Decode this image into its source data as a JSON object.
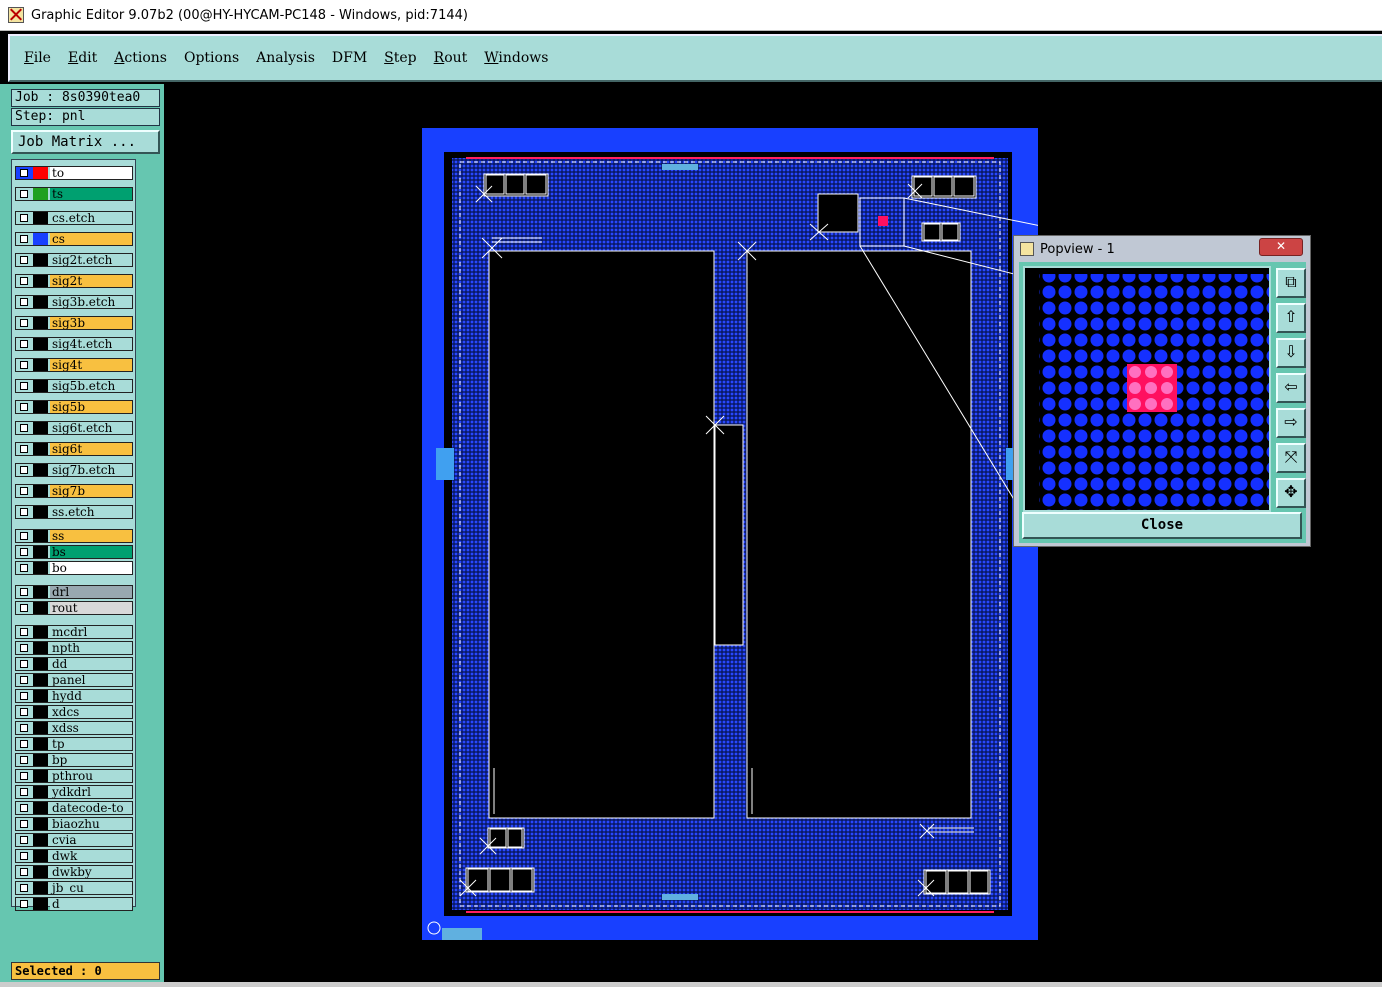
{
  "window": {
    "title": "Graphic Editor 9.07b2 (00@HY-HYCAM-PC148 - Windows, pid:7144)"
  },
  "menu": [
    {
      "label": "File",
      "underline": true
    },
    {
      "label": "Edit",
      "underline": true
    },
    {
      "label": "Actions",
      "underline": true
    },
    {
      "label": "Options",
      "underline": false
    },
    {
      "label": "Analysis",
      "underline": false
    },
    {
      "label": "DFM",
      "underline": false
    },
    {
      "label": "Step",
      "underline": true
    },
    {
      "label": "Rout",
      "underline": true
    },
    {
      "label": "Windows",
      "underline": true
    }
  ],
  "job": {
    "label": "Job : 8s0390tea0",
    "step": "Step: pnl"
  },
  "job_matrix": "Job Matrix ...",
  "layers": [
    {
      "name": "to",
      "color": "#ffffff",
      "swatch": "#ff0000",
      "highlight": true
    },
    {
      "name": "ts",
      "color": "#00a070",
      "swatch": "#20a020"
    },
    {
      "name": "cs.etch",
      "color": "#a8dcd8",
      "swatch": "#000000"
    },
    {
      "name": "cs",
      "color": "#f8c040",
      "swatch": "#1840ff"
    },
    {
      "name": "sig2t.etch",
      "color": "#a8dcd8",
      "swatch": "#000000"
    },
    {
      "name": "sig2t",
      "color": "#f8c040",
      "swatch": "#000000"
    },
    {
      "name": "sig3b.etch",
      "color": "#a8dcd8",
      "swatch": "#000000"
    },
    {
      "name": "sig3b",
      "color": "#f8c040",
      "swatch": "#000000"
    },
    {
      "name": "sig4t.etch",
      "color": "#a8dcd8",
      "swatch": "#000000"
    },
    {
      "name": "sig4t",
      "color": "#f8c040",
      "swatch": "#000000"
    },
    {
      "name": "sig5b.etch",
      "color": "#a8dcd8",
      "swatch": "#000000"
    },
    {
      "name": "sig5b",
      "color": "#f8c040",
      "swatch": "#000000"
    },
    {
      "name": "sig6t.etch",
      "color": "#a8dcd8",
      "swatch": "#000000"
    },
    {
      "name": "sig6t",
      "color": "#f8c040",
      "swatch": "#000000"
    },
    {
      "name": "sig7b.etch",
      "color": "#a8dcd8",
      "swatch": "#000000"
    },
    {
      "name": "sig7b",
      "color": "#f8c040",
      "swatch": "#000000"
    },
    {
      "name": "ss.etch",
      "color": "#a8dcd8",
      "swatch": "#000000"
    },
    {
      "name": "ss",
      "color": "#f8c040",
      "swatch": "#000000"
    },
    {
      "name": "bs",
      "color": "#00a070",
      "swatch": "#000000"
    },
    {
      "name": "bo",
      "color": "#ffffff",
      "swatch": "#000000"
    },
    {
      "name": "drl",
      "color": "#98a8b0",
      "swatch": "#000000"
    },
    {
      "name": "rout",
      "color": "#d8d8d8",
      "swatch": "#000000"
    },
    {
      "name": "mcdrl",
      "color": "#a8dcd8",
      "swatch": "#000000"
    },
    {
      "name": "npth",
      "color": "#a8dcd8",
      "swatch": "#000000"
    },
    {
      "name": "dd",
      "color": "#a8dcd8",
      "swatch": "#000000"
    },
    {
      "name": "panel",
      "color": "#a8dcd8",
      "swatch": "#000000"
    },
    {
      "name": "hydd",
      "color": "#a8dcd8",
      "swatch": "#000000"
    },
    {
      "name": "xdcs",
      "color": "#a8dcd8",
      "swatch": "#000000"
    },
    {
      "name": "xdss",
      "color": "#a8dcd8",
      "swatch": "#000000"
    },
    {
      "name": "tp",
      "color": "#a8dcd8",
      "swatch": "#000000"
    },
    {
      "name": "bp",
      "color": "#a8dcd8",
      "swatch": "#000000"
    },
    {
      "name": "pthrou",
      "color": "#a8dcd8",
      "swatch": "#000000"
    },
    {
      "name": "ydkdrl",
      "color": "#a8dcd8",
      "swatch": "#000000"
    },
    {
      "name": "datecode-to",
      "color": "#a8dcd8",
      "swatch": "#000000"
    },
    {
      "name": "biaozhu",
      "color": "#a8dcd8",
      "swatch": "#000000"
    },
    {
      "name": "cvia",
      "color": "#a8dcd8",
      "swatch": "#000000"
    },
    {
      "name": "dwk",
      "color": "#a8dcd8",
      "swatch": "#000000"
    },
    {
      "name": "dwkby",
      "color": "#a8dcd8",
      "swatch": "#000000"
    },
    {
      "name": "jb_cu",
      "color": "#a8dcd8",
      "swatch": "#000000"
    },
    {
      "name": "d",
      "color": "#a8dcd8",
      "swatch": "#000000"
    }
  ],
  "selected": "Selected : 0",
  "popview": {
    "title": "Popview - 1",
    "close_label": "Close",
    "buttons": [
      "fit-view-icon",
      "pan-up-icon",
      "pan-down-icon",
      "pan-left-icon",
      "pan-right-icon",
      "zoom-out-icon",
      "zoom-in-icon"
    ]
  },
  "colors": {
    "board": "#1840ff",
    "panel_bg": "#66c6b0",
    "control": "#a8dcd8",
    "selected": "#f8c040",
    "highlight_pad": "#ff1060"
  }
}
